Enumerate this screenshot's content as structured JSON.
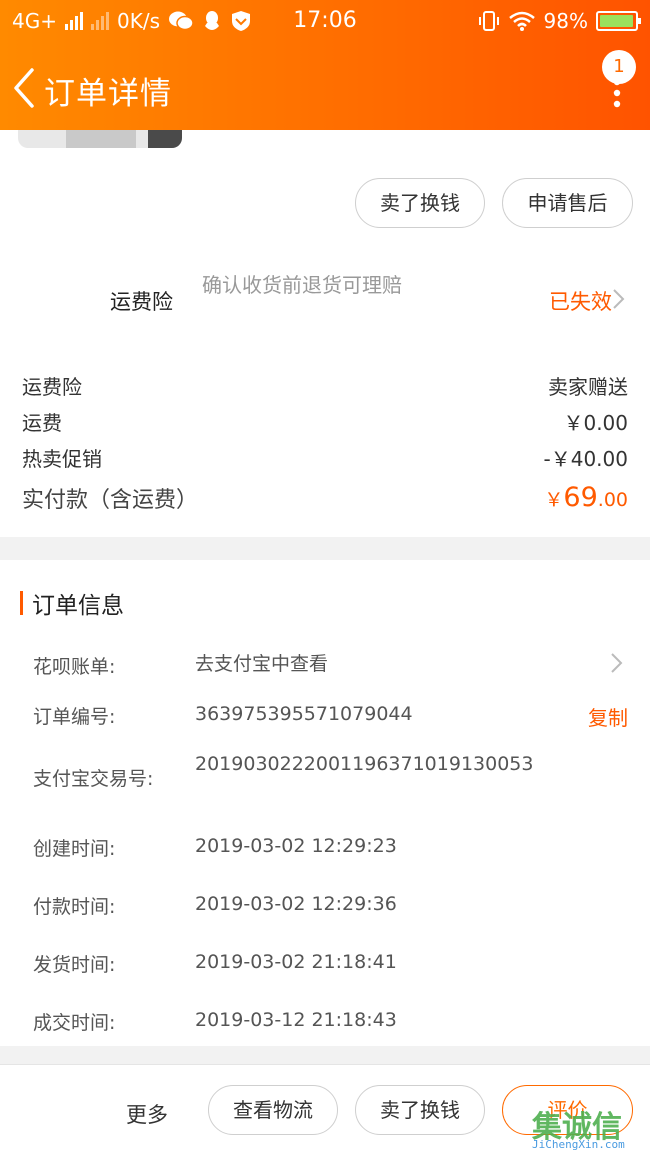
{
  "status_bar": {
    "network": "4G+",
    "speed": "0K/s",
    "time": "17:06",
    "battery": "98%",
    "battery_level": 0.98
  },
  "nav": {
    "title": "订单详情",
    "badge_count": "1"
  },
  "actions_top": {
    "sell_label": "卖了换钱",
    "after_sale_label": "申请售后"
  },
  "insurance": {
    "label": "运费险",
    "desc": "确认收货前退货可理赔",
    "status": "已失效",
    "status_color": "#ff5a00"
  },
  "price": {
    "rows": [
      {
        "label": "运费险",
        "value": "卖家赠送"
      },
      {
        "label": "运费",
        "value": "￥0.00"
      },
      {
        "label": "热卖促销",
        "value": "-￥40.00"
      }
    ],
    "total_label": "实付款（含运费）",
    "total_symbol": "￥",
    "total_int": "69",
    "total_dec": ".00"
  },
  "order_info": {
    "title": "订单信息",
    "huabei_label": "花呗账单:",
    "huabei_value": "去支付宝中查看",
    "order_no_label": "订单编号:",
    "order_no_value": "363975395571079044",
    "copy_label": "复制",
    "alipay_label": "支付宝交易号:",
    "alipay_value": "20190302220011963710191300​53",
    "created_label": "创建时间:",
    "created_value": "2019-03-02 12:29:23",
    "paid_label": "付款时间:",
    "paid_value": "2019-03-02 12:29:36",
    "shipped_label": "发货时间:",
    "shipped_value": "2019-03-02 21:18:41",
    "closed_label": "成交时间:",
    "closed_value": "2019-03-12 21:18:43"
  },
  "bottom_bar": {
    "more_label": "更多",
    "logistics_label": "查看物流",
    "sell_label": "卖了换钱",
    "rate_label": "评价"
  },
  "watermark": {
    "logo": "集诚信",
    "url": "JiChengXin.com"
  }
}
